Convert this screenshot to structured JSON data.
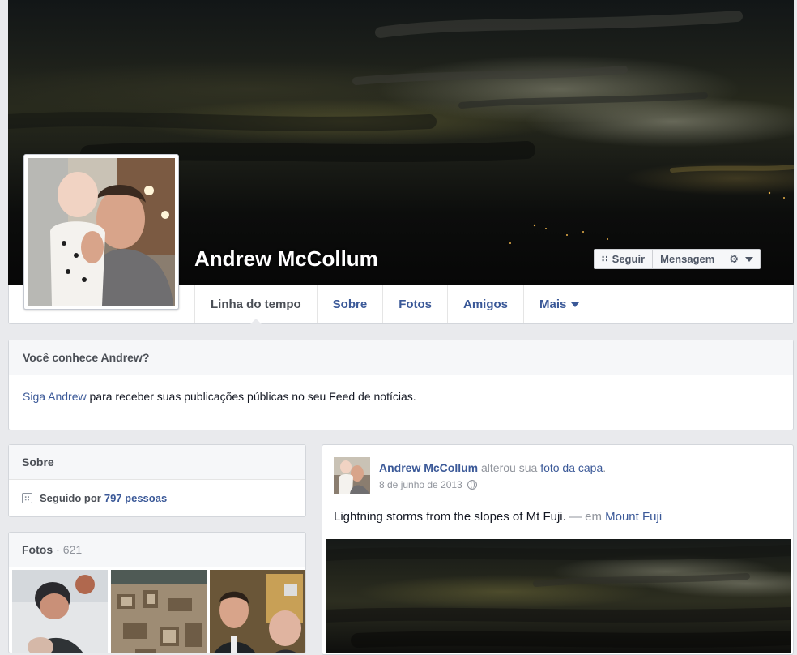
{
  "profile": {
    "name": "Andrew McCollum"
  },
  "actions": {
    "follow_label": "Seguir",
    "message_label": "Mensagem"
  },
  "tabs": [
    {
      "label": "Linha do tempo",
      "active": true
    },
    {
      "label": "Sobre"
    },
    {
      "label": "Fotos"
    },
    {
      "label": "Amigos"
    },
    {
      "label": "Mais"
    }
  ],
  "know_box": {
    "title": "Você conhece Andrew?",
    "link": "Siga Andrew",
    "text": " para receber suas publicações públicas no seu Feed de notícias."
  },
  "about": {
    "title": "Sobre",
    "followed_prefix": "Seguido por",
    "followed_count": "797 pessoas"
  },
  "photos": {
    "title": "Fotos",
    "separator": "·",
    "count": "621"
  },
  "post": {
    "author": "Andrew McCollum",
    "action": " alterou sua ",
    "action_link": "foto da capa",
    "action_end": ".",
    "date": "8 de junho de 2013",
    "text": "Lightning storms from the slopes of Mt Fuji.",
    "location_prefix": " — em ",
    "location": "Mount Fuji"
  },
  "colors": {
    "link": "#3b5998",
    "background": "#e9eaed",
    "muted": "#90949c"
  },
  "icons": {
    "follow": "rss-icon",
    "settings": "gear-icon",
    "privacy": "globe-icon"
  }
}
